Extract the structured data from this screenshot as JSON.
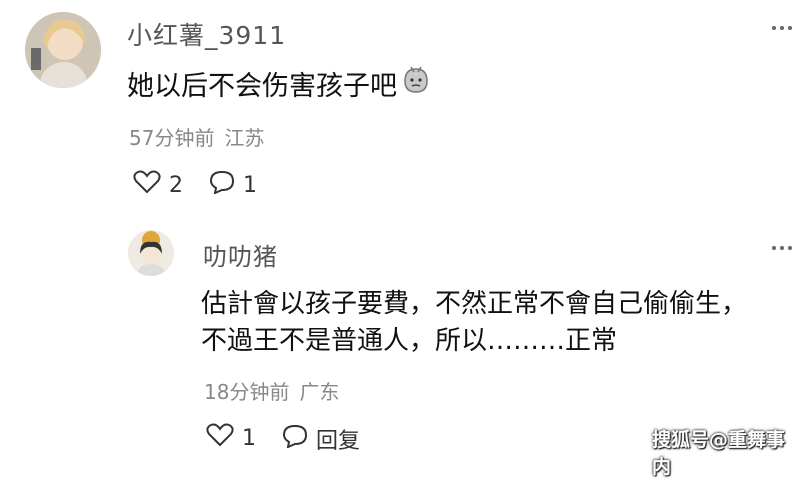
{
  "comment": {
    "username": "小红薯_3911",
    "text": "她以后不会伤害孩子吧",
    "time": "57分钟前",
    "location": "江苏",
    "likes": "2",
    "replies": "1",
    "more_label": "⋮"
  },
  "reply": {
    "username": "叻叻猪",
    "text_line1": "估計會以孩子要費，不然正常不會自己偷偷生，",
    "text_line2": "不過王不是普通人，所以………正常",
    "time": "18分钟前",
    "location": "广东",
    "likes": "1",
    "reply_label": "回复",
    "more_label": "⋮"
  },
  "watermark": "搜狐号@重舞事内",
  "icons": [
    "heart-icon",
    "comment-bubble-icon",
    "more-icon",
    "emoji-icon"
  ]
}
